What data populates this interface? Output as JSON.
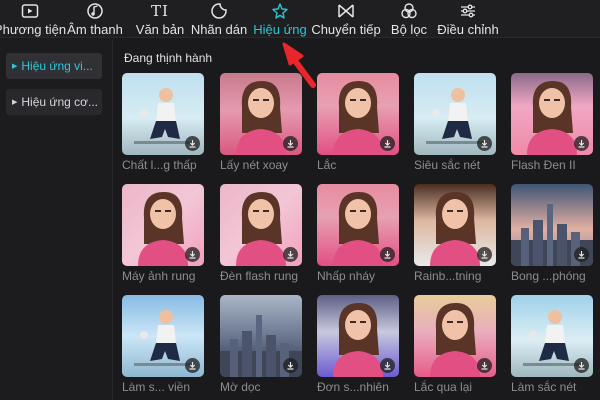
{
  "toolbar": {
    "items": [
      {
        "label": "Phương tiện",
        "icon": "media-icon"
      },
      {
        "label": "Âm thanh",
        "icon": "audio-icon"
      },
      {
        "label": "Văn bản",
        "icon": "text-icon"
      },
      {
        "label": "Nhãn dán",
        "icon": "sticker-icon"
      },
      {
        "label": "Hiệu ứng",
        "icon": "effects-icon"
      },
      {
        "label": "Chuyển tiếp",
        "icon": "transition-icon"
      },
      {
        "label": "Bộ lọc",
        "icon": "filter-icon"
      },
      {
        "label": "Điều chỉnh",
        "icon": "adjust-icon"
      }
    ],
    "text_icon_glyph": "TI",
    "active_index": 4,
    "accent_color": "#29c6d6"
  },
  "sidebar": {
    "items": [
      {
        "label": "Hiệu ứng vi..."
      },
      {
        "label": "Hiệu ứng cơ..."
      }
    ]
  },
  "main": {
    "section_title": "Đang thịnh hành",
    "cards": [
      {
        "caption": "Chất l...g thấp"
      },
      {
        "caption": "Lấy nét xoay"
      },
      {
        "caption": "Lắc"
      },
      {
        "caption": "Siêu sắc nét"
      },
      {
        "caption": "Flash Đen II"
      },
      {
        "caption": "Máy ảnh rung"
      },
      {
        "caption": "Đèn flash rung"
      },
      {
        "caption": "Nhấp nháy"
      },
      {
        "caption": "Rainb...tning"
      },
      {
        "caption": "Bong ...phóng"
      },
      {
        "caption": "Làm s... viền"
      },
      {
        "caption": "Mờ dọc"
      },
      {
        "caption": "Đơn s...nhiên"
      },
      {
        "caption": "Lắc qua lại"
      },
      {
        "caption": "Làm sắc nét"
      }
    ]
  },
  "annotation": {
    "arrow_color": "#e8262b"
  }
}
